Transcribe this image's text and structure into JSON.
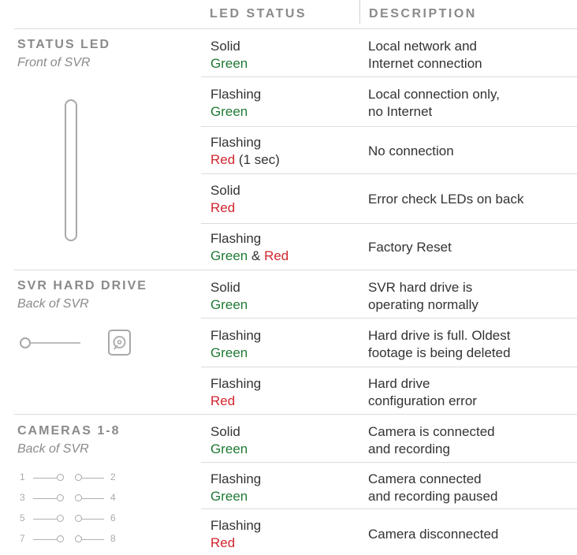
{
  "headers": {
    "led_status": "LED STATUS",
    "description": "DESCRIPTION"
  },
  "colors": {
    "green": "#1f7a33",
    "red": "#d0262f"
  },
  "sections": [
    {
      "title": "STATUS LED",
      "subtitle": "Front of SVR",
      "icon": "vertical-led-bar-icon",
      "rows": [
        {
          "mode": "Solid",
          "color": "Green",
          "description": [
            "Local network and",
            "Internet connection"
          ]
        },
        {
          "mode": "Flashing",
          "color": "Green",
          "description": [
            "Local connection only,",
            "no Internet"
          ]
        },
        {
          "mode": "Flashing",
          "color": "Red",
          "suffix": "(1 sec)",
          "description": [
            "No connection"
          ]
        },
        {
          "mode": "Solid",
          "color": "Red",
          "description": [
            "Error check LEDs on back"
          ]
        },
        {
          "mode": "Flashing",
          "color": "Green",
          "connector": "&",
          "color2": "Red",
          "description": [
            "Factory Reset"
          ]
        }
      ]
    },
    {
      "title": "SVR HARD DRIVE",
      "subtitle": "Back of SVR",
      "icon": "hard-drive-icon",
      "rows": [
        {
          "mode": "Solid",
          "color": "Green",
          "description": [
            "SVR hard drive is",
            "operating normally"
          ]
        },
        {
          "mode": "Flashing",
          "color": "Green",
          "description": [
            "Hard drive is full. Oldest",
            "footage is being deleted"
          ]
        },
        {
          "mode": "Flashing",
          "color": "Red",
          "description": [
            "Hard drive",
            "configuration error"
          ]
        }
      ]
    },
    {
      "title": "CAMERAS 1-8",
      "subtitle": "Back of SVR",
      "icon": "camera-ports-icon",
      "camera_numbers": [
        "1",
        "2",
        "3",
        "4",
        "5",
        "6",
        "7",
        "8"
      ],
      "rows": [
        {
          "mode": "Solid",
          "color": "Green",
          "description": [
            "Camera is connected",
            "and recording"
          ]
        },
        {
          "mode": "Flashing",
          "color": "Green",
          "description": [
            "Camera connected",
            "and recording paused"
          ]
        },
        {
          "mode": "Flashing",
          "color": "Red",
          "description": [
            "Camera disconnected"
          ]
        }
      ]
    }
  ]
}
